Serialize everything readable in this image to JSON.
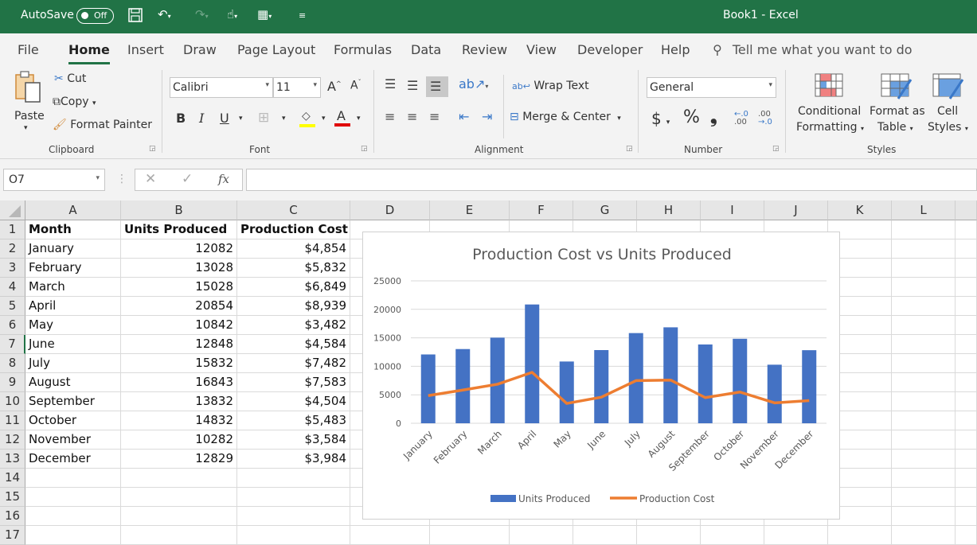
{
  "titlebar": {
    "autosave_label": "AutoSave",
    "autosave_state": "Off",
    "title": "Book1  -  Excel"
  },
  "tabs": [
    "File",
    "Home",
    "Insert",
    "Draw",
    "Page Layout",
    "Formulas",
    "Data",
    "Review",
    "View",
    "Developer",
    "Help"
  ],
  "active_tab": "Home",
  "tell_me": "Tell me what you want to do",
  "ribbon": {
    "clipboard": {
      "paste": "Paste",
      "cut": "Cut",
      "copy": "Copy",
      "format_painter": "Format Painter",
      "label": "Clipboard"
    },
    "font": {
      "name": "Calibri",
      "size": "11",
      "bold": "B",
      "italic": "I",
      "underline": "U",
      "label": "Font"
    },
    "alignment": {
      "wrap_text": "Wrap Text",
      "merge_center": "Merge & Center",
      "label": "Alignment"
    },
    "number": {
      "format": "General",
      "currency": "$",
      "percent": "%",
      "comma": "❟",
      "label": "Number"
    },
    "styles": {
      "conditional_1": "Conditional",
      "conditional_2": "Formatting",
      "table_1": "Format as",
      "table_2": "Table",
      "cell_1": "Cell",
      "cell_2": "Styles",
      "label": "Styles"
    }
  },
  "formula_bar": {
    "name_box": "O7",
    "fx": "fx",
    "value": ""
  },
  "columns": [
    "A",
    "B",
    "C",
    "D",
    "E",
    "F",
    "G",
    "H",
    "I",
    "J",
    "K",
    "L"
  ],
  "rows": [
    "1",
    "2",
    "3",
    "4",
    "5",
    "6",
    "7",
    "8",
    "9",
    "10",
    "11",
    "12",
    "13",
    "14",
    "15",
    "16",
    "17"
  ],
  "table": {
    "headers": [
      "Month",
      "Units Produced",
      "Production Cost"
    ],
    "data": [
      [
        "January",
        "12082",
        "$4,854"
      ],
      [
        "February",
        "13028",
        "$5,832"
      ],
      [
        "March",
        "15028",
        "$6,849"
      ],
      [
        "April",
        "20854",
        "$8,939"
      ],
      [
        "May",
        "10842",
        "$3,482"
      ],
      [
        "June",
        "12848",
        "$4,584"
      ],
      [
        "July",
        "15832",
        "$7,482"
      ],
      [
        "August",
        "16843",
        "$7,583"
      ],
      [
        "September",
        "13832",
        "$4,504"
      ],
      [
        "October",
        "14832",
        "$5,483"
      ],
      [
        "November",
        "10282",
        "$3,584"
      ],
      [
        "December",
        "12829",
        "$3,984"
      ]
    ]
  },
  "colors": {
    "brand": "#217346",
    "bar": "#4472C4",
    "line": "#ED7D31"
  },
  "chart_data": {
    "type": "bar",
    "title": "Production Cost vs Units Produced",
    "categories": [
      "January",
      "February",
      "March",
      "April",
      "May",
      "June",
      "July",
      "August",
      "September",
      "October",
      "November",
      "December"
    ],
    "series": [
      {
        "name": "Units Produced",
        "type": "bar",
        "values": [
          12082,
          13028,
          15028,
          20854,
          10842,
          12848,
          15832,
          16843,
          13832,
          14832,
          10282,
          12829
        ]
      },
      {
        "name": "Production Cost",
        "type": "line",
        "values": [
          4854,
          5832,
          6849,
          8939,
          3482,
          4584,
          7482,
          7583,
          4504,
          5483,
          3584,
          3984
        ]
      }
    ],
    "yticks": [
      "0",
      "5000",
      "10000",
      "15000",
      "20000",
      "25000"
    ],
    "ylim": [
      0,
      25000
    ],
    "grid": true,
    "legend": "bottom",
    "xlabel": "",
    "ylabel": ""
  }
}
